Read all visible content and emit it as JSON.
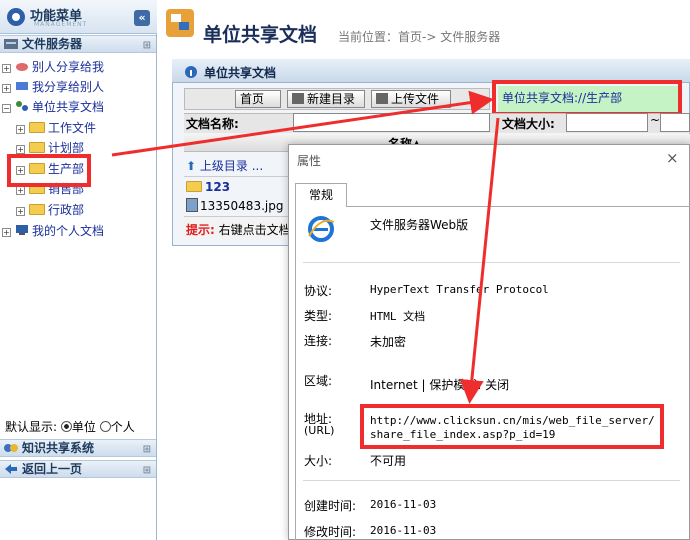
{
  "sidebar": {
    "title": "功能菜单",
    "subtitle": "MANAGEMENT",
    "collapse_label": "«",
    "section_file_server": "文件服务器",
    "tree": [
      {
        "label": "别人分享给我"
      },
      {
        "label": "我分享给别人"
      },
      {
        "label": "单位共享文档"
      },
      {
        "label": "工作文件"
      },
      {
        "label": "计划部"
      },
      {
        "label": "生产部"
      },
      {
        "label": "销售部"
      },
      {
        "label": "行政部"
      },
      {
        "label": "我的个人文档"
      }
    ],
    "default_display_label": "默认显示:",
    "radio_unit": "单位",
    "radio_personal": "个人",
    "section_knowledge": "知识共享系统",
    "section_back": "返回上一页",
    "section_plus": "⊞"
  },
  "header": {
    "title": "单位共享文档",
    "breadcrumb": "当前位置：首页-> 文件服务器"
  },
  "panel": {
    "title": "单位共享文档",
    "toolbar": {
      "home": "首页",
      "new_dir": "新建目录",
      "upload": "上传文件"
    },
    "path_label": "单位共享文档://生产部",
    "filter_name_label": "文档名称:",
    "filter_size_label": "文档大小:",
    "filter_tilde": "~",
    "col_name": "名称▲",
    "up_dir": "上级目录 ...",
    "rows": [
      {
        "name": "123"
      },
      {
        "name": "13350483.jpg"
      }
    ],
    "tip_label": "提示:",
    "tip_text": "右键点击文档"
  },
  "properties": {
    "title": "属性",
    "close": "×",
    "tab": "常规",
    "app_name": "文件服务器Web版",
    "rows": [
      {
        "label": "协议:",
        "value": "HyperText Transfer Protocol"
      },
      {
        "label": "类型:",
        "value": "HTML 文档"
      },
      {
        "label": "连接:",
        "value": "未加密"
      }
    ],
    "zone_label": "区域:",
    "zone_value": "Internet | 保护模式: 关闭",
    "address_label": "地址:",
    "address_label_2": "(URL)",
    "address_value": "http://www.clicksun.cn/mis/web_file_server/share_file_index.asp?p_id=19",
    "size_label": "大小:",
    "size_value": "不可用",
    "created_label": "创建时间:",
    "created_value": "2016-11-03",
    "modified_label": "修改时间:",
    "modified_value": "2016-11-03"
  },
  "colors": {
    "annotation_red": "#ef2d2d",
    "tree_blue": "#1a2f9a",
    "path_green": "#c5f3c5"
  }
}
